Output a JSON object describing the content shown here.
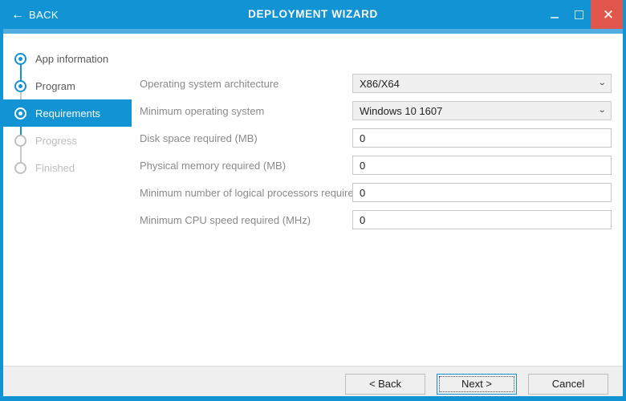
{
  "titlebar": {
    "back_label": "BACK",
    "back_icon": "arrow-left-icon",
    "title": "DEPLOYMENT WIZARD",
    "minimize_icon": "minimize-icon",
    "maximize_icon": "maximize-icon",
    "close_label": "✕",
    "accent_color": "#1193d4",
    "close_color": "#e0564c"
  },
  "sidebar": {
    "items": [
      {
        "label": "App information",
        "state": "done"
      },
      {
        "label": "Program",
        "state": "done"
      },
      {
        "label": "Requirements",
        "state": "active"
      },
      {
        "label": "Progress",
        "state": "pending"
      },
      {
        "label": "Finished",
        "state": "pending"
      }
    ]
  },
  "form": {
    "rows": [
      {
        "label": "Operating system architecture",
        "type": "select",
        "value": "X86/X64",
        "chevron": "⌄"
      },
      {
        "label": "Minimum operating system",
        "type": "select",
        "value": "Windows 10 1607",
        "chevron": "⌄"
      },
      {
        "label": "Disk space required (MB)",
        "type": "text",
        "value": "0"
      },
      {
        "label": "Physical memory required (MB)",
        "type": "text",
        "value": "0"
      },
      {
        "label": "Minimum number of logical processors required",
        "type": "text",
        "value": "0"
      },
      {
        "label": "Minimum CPU speed required (MHz)",
        "type": "text",
        "value": "0"
      }
    ]
  },
  "footer": {
    "back_button": "< Back",
    "next_button": "Next >",
    "cancel_button": "Cancel"
  }
}
